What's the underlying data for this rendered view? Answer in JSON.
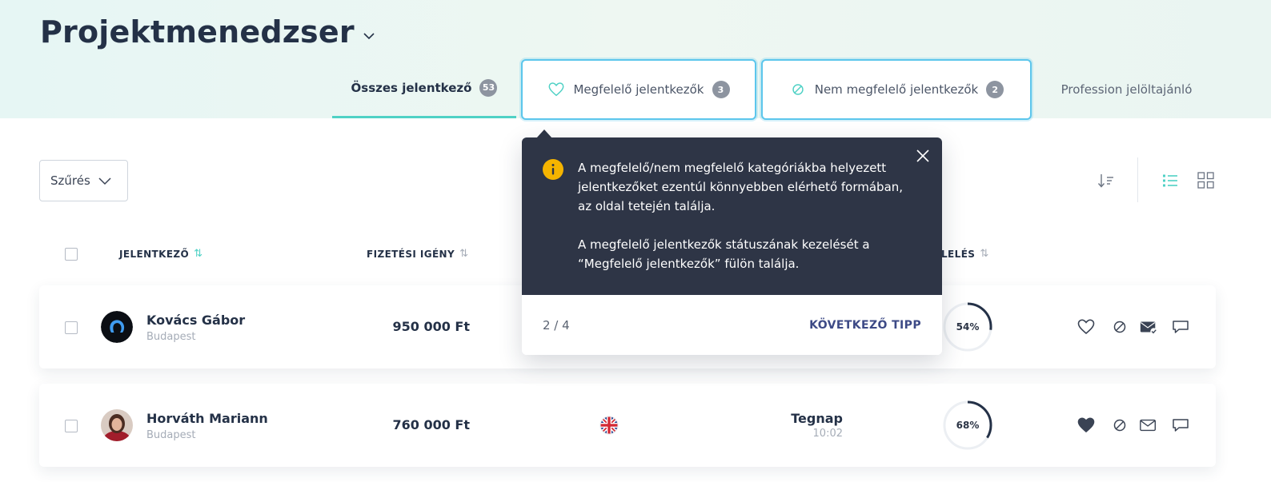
{
  "header": {
    "title": "Projektmenedzser"
  },
  "tabs": [
    {
      "label": "Összes jelentkező",
      "count": "53"
    },
    {
      "label": "Megfelelő jelentkezők",
      "count": "3"
    },
    {
      "label": "Nem megfelelő jelentkezők",
      "count": "2"
    },
    {
      "label": "Profession jelöltajánló"
    }
  ],
  "tooltip": {
    "paragraph1": "A megfelelő/nem megfelelő kategóriákba helyezett jelentkezőket ezentúl könnyebben elérhető formában, az oldal tetején találja.",
    "paragraph2": "A megfelelő jelentkezők státuszának kezelését a “Megfelelő jelentkezők” fülön találja.",
    "step": "2 / 4",
    "next_label": "KÖVETKEZŐ TIPP"
  },
  "toolbar": {
    "filter_label": "Szűrés"
  },
  "columns": {
    "applicant": "JELENTKEZŐ",
    "salary": "FIZETÉSI IGÉNY",
    "match": "LELÉS",
    "sort_glyph": "⇅"
  },
  "rows": [
    {
      "name": "Kovács Gábor",
      "city": "Budapest",
      "salary": "950 000 Ft",
      "score": "54%",
      "score_fraction": 0.54,
      "favorited": false
    },
    {
      "name": "Horváth Mariann",
      "city": "Budapest",
      "salary": "760 000 Ft",
      "date": "Tegnap",
      "time": "10:02",
      "score": "68%",
      "score_fraction": 0.68,
      "favorited": true
    }
  ],
  "colors": {
    "accent_teal": "#4fd1c5",
    "tab_highlight": "#5cc6ec",
    "tooltip_bg": "#2e3546",
    "info_yellow": "#f5b400",
    "next_tip": "#3d4a86"
  }
}
